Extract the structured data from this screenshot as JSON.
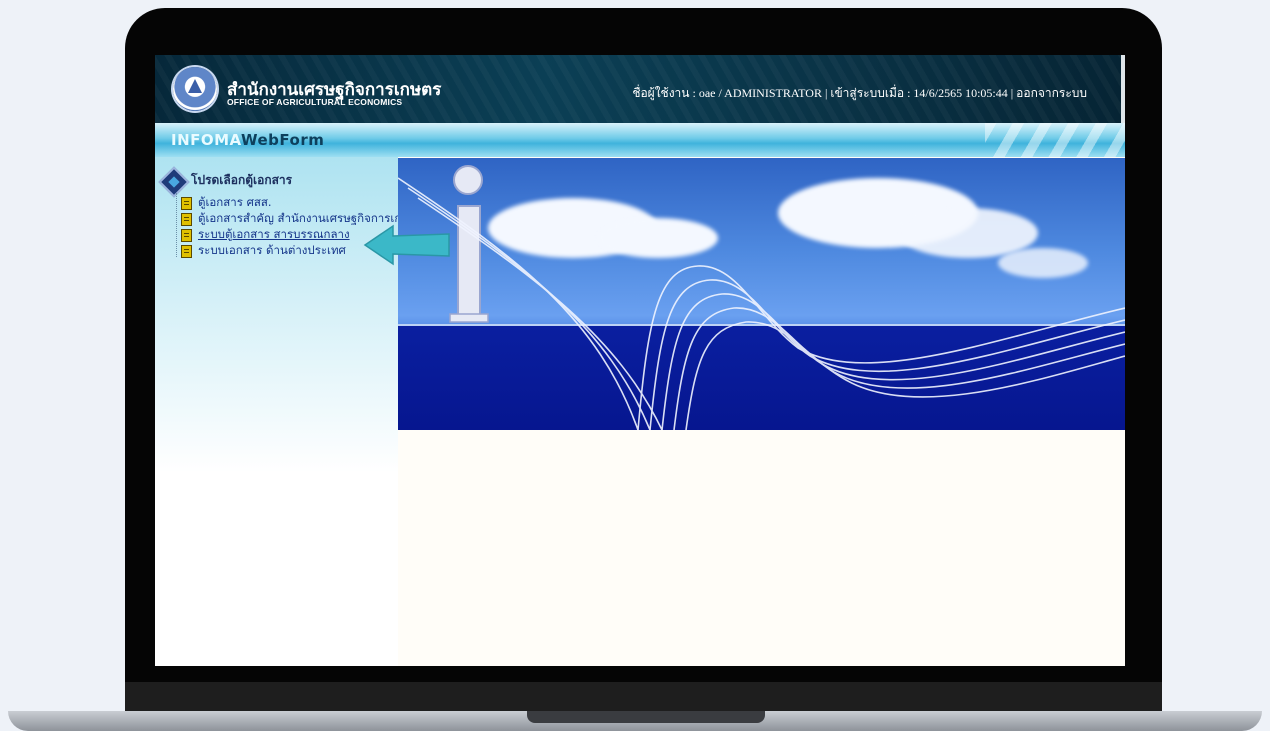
{
  "header": {
    "org_name_th": "สำนักงานเศรษฐกิจการเกษตร",
    "org_name_en": "OFFICE OF AGRICULTURAL ECONOMICS",
    "user_label": "ชื่อผู้ใช้งาน : oae / ADMINISTRATOR",
    "login_label": "เข้าสู่ระบบเมื่อ : 14/6/2565 10:05:44",
    "separator": "|",
    "logout_label": "ออกจากระบบ"
  },
  "brand": {
    "part1": "INFOMA",
    "part2": "WebForm"
  },
  "sidebar": {
    "root_label": "โปรดเลือกตู้เอกสาร",
    "items": [
      {
        "label": "ตู้เอกสาร ศสส."
      },
      {
        "label": "ตู้เอกสารสำคัญ สำนักงานเศรษฐกิจการเกษตร"
      },
      {
        "label": "ระบบตู้เอกสาร สารบรรณกลาง"
      },
      {
        "label": "ระบบเอกสาร ด้านต่างประเทศ"
      }
    ]
  },
  "colors": {
    "header_bg": "#0b3f55",
    "link": "#15358a",
    "arrow_accent": "#3bb8c8"
  }
}
